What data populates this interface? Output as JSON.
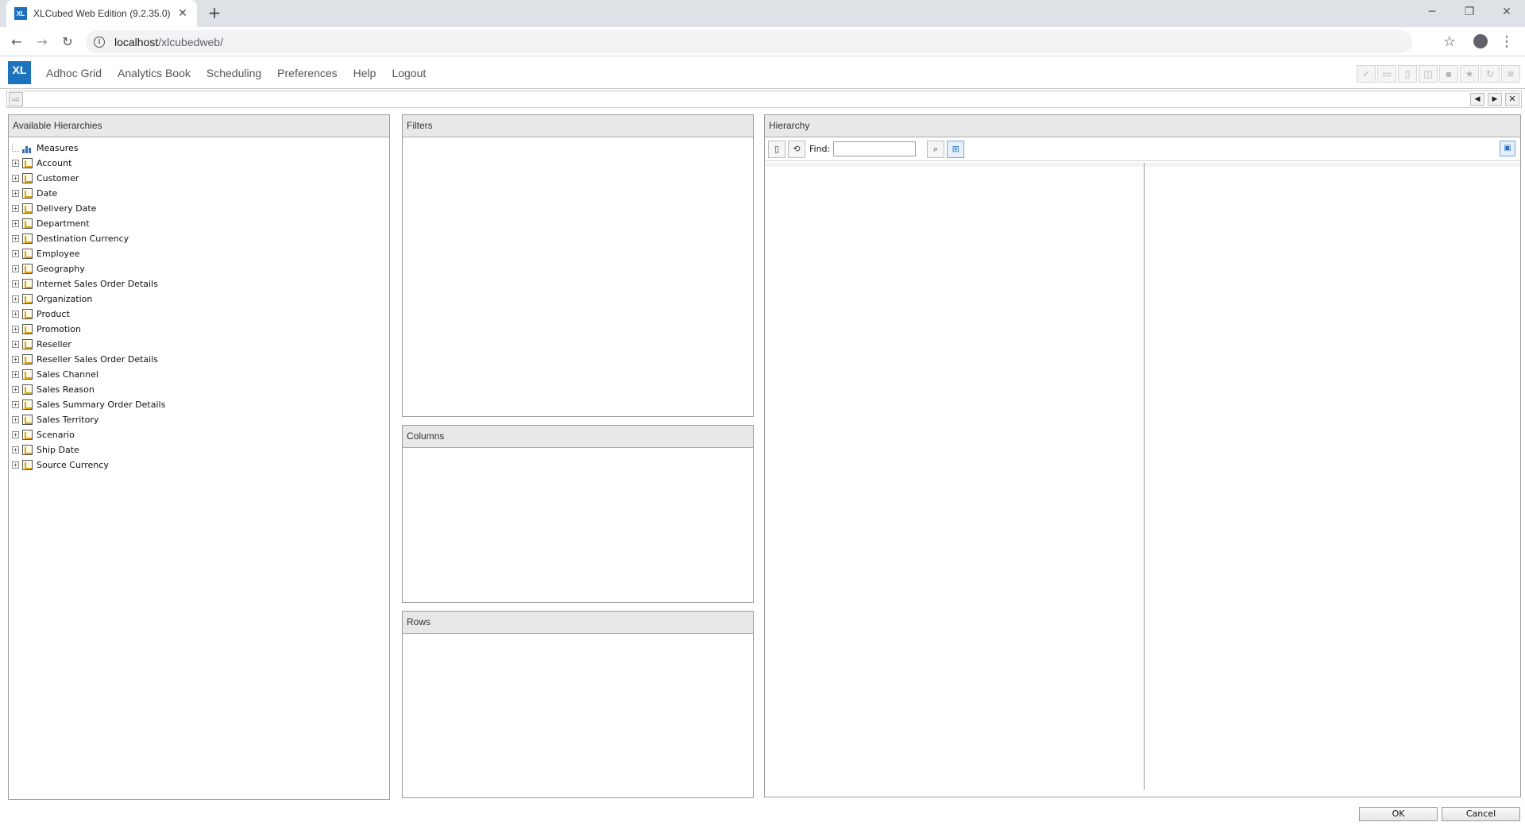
{
  "browser": {
    "tab_title": "XLCubed Web Edition (9.2.35.0)",
    "favicon_text": "XL",
    "url_host": "localhost",
    "url_path": "/xlcubedweb/"
  },
  "app": {
    "logo_text": "XL",
    "menu": [
      "Adhoc Grid",
      "Analytics Book",
      "Scheduling",
      "Preferences",
      "Help",
      "Logout"
    ]
  },
  "panels": {
    "available_title": "Available Hierarchies",
    "filters_title": "Filters",
    "columns_title": "Columns",
    "rows_title": "Rows",
    "hierarchy_title": "Hierarchy"
  },
  "hierarchies": [
    {
      "label": "Measures",
      "kind": "measures"
    },
    {
      "label": "Account",
      "kind": "dimension"
    },
    {
      "label": "Customer",
      "kind": "dimension"
    },
    {
      "label": "Date",
      "kind": "dimension"
    },
    {
      "label": "Delivery Date",
      "kind": "dimension"
    },
    {
      "label": "Department",
      "kind": "dimension"
    },
    {
      "label": "Destination Currency",
      "kind": "dimension"
    },
    {
      "label": "Employee",
      "kind": "dimension"
    },
    {
      "label": "Geography",
      "kind": "dimension"
    },
    {
      "label": "Internet Sales Order Details",
      "kind": "dimension"
    },
    {
      "label": "Organization",
      "kind": "dimension"
    },
    {
      "label": "Product",
      "kind": "dimension"
    },
    {
      "label": "Promotion",
      "kind": "dimension"
    },
    {
      "label": "Reseller",
      "kind": "dimension"
    },
    {
      "label": "Reseller Sales Order Details",
      "kind": "dimension"
    },
    {
      "label": "Sales Channel",
      "kind": "dimension"
    },
    {
      "label": "Sales Reason",
      "kind": "dimension"
    },
    {
      "label": "Sales Summary Order Details",
      "kind": "dimension"
    },
    {
      "label": "Sales Territory",
      "kind": "dimension"
    },
    {
      "label": "Scenario",
      "kind": "dimension"
    },
    {
      "label": "Ship Date",
      "kind": "dimension"
    },
    {
      "label": "Source Currency",
      "kind": "dimension"
    }
  ],
  "hierarchy_toolbar": {
    "find_label": "Find:",
    "find_value": ""
  },
  "buttons": {
    "ok": "OK",
    "cancel": "Cancel"
  }
}
